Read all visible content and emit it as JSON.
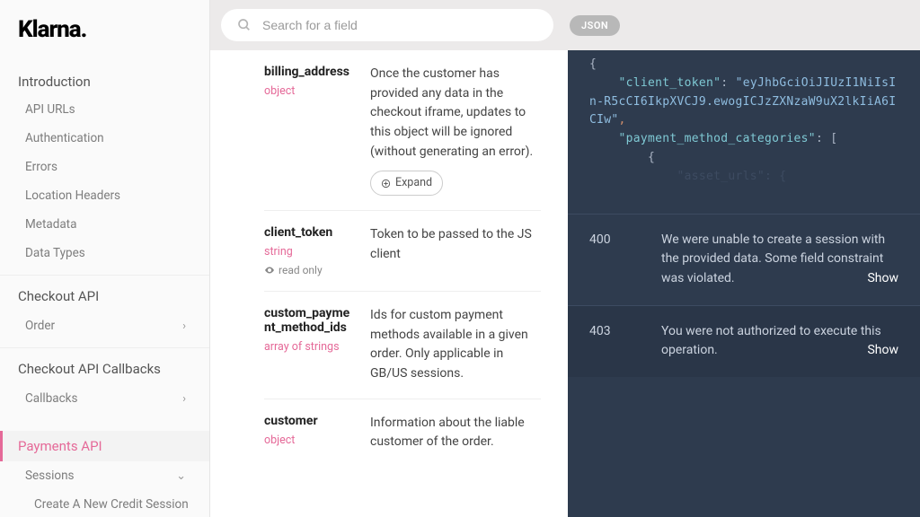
{
  "brand": "Klarna.",
  "search": {
    "placeholder": "Search for a field"
  },
  "toolbar": {
    "json_label": "JSON"
  },
  "sidebar": {
    "items": [
      {
        "label": "Introduction",
        "kind": "section"
      },
      {
        "label": "API URLs",
        "kind": "item"
      },
      {
        "label": "Authentication",
        "kind": "item"
      },
      {
        "label": "Errors",
        "kind": "item"
      },
      {
        "label": "Location Headers",
        "kind": "item"
      },
      {
        "label": "Metadata",
        "kind": "item"
      },
      {
        "label": "Data Types",
        "kind": "item"
      },
      {
        "label": "Checkout API",
        "kind": "category"
      },
      {
        "label": "Order",
        "kind": "item",
        "chevron": "right"
      },
      {
        "label": "Checkout API Callbacks",
        "kind": "category"
      },
      {
        "label": "Callbacks",
        "kind": "item",
        "chevron": "right"
      },
      {
        "label": "Payments API",
        "kind": "category",
        "active": true
      },
      {
        "label": "Sessions",
        "kind": "item",
        "chevron": "down"
      },
      {
        "label": "Create A New Credit Session",
        "kind": "subitem"
      }
    ]
  },
  "fields": [
    {
      "name": "billing_address",
      "type": "object",
      "desc": "Once the customer has provided any data in the checkout iframe, updates to this object will be ignored (without generating an error).",
      "expand": "Expand"
    },
    {
      "name": "client_token",
      "type": "string",
      "readonly": "read only",
      "desc": "Token to be passed to the JS client"
    },
    {
      "name": "custom_payment_method_ids",
      "type": "array of strings",
      "desc": "Ids for custom payment methods available in a given order. Only applicable in GB/US sessions."
    },
    {
      "name": "customer",
      "type": "object",
      "desc": "Information about the liable customer of the order."
    }
  ],
  "code": {
    "brace_open": "{",
    "key1": "\"client_token\"",
    "val1": "\"eyJhbGciOiJIUzI1NiIsIn-R5cCI6IkpXVCJ9.ewogICJzZXNzaW9uX2lkIiA6ICIw\"",
    "comma": ",",
    "key2": "\"payment_method_categories\"",
    "colon_bracket": ": [",
    "brace_open2": "{",
    "dim_line": "\"asset_urls\": {"
  },
  "statuses": [
    {
      "code": "400",
      "msg": "We were unable to create a session with the provided data. Some field constraint was violated.",
      "show": "Show"
    },
    {
      "code": "403",
      "msg": "You were not authorized to execute this operation.",
      "show": "Show"
    }
  ]
}
